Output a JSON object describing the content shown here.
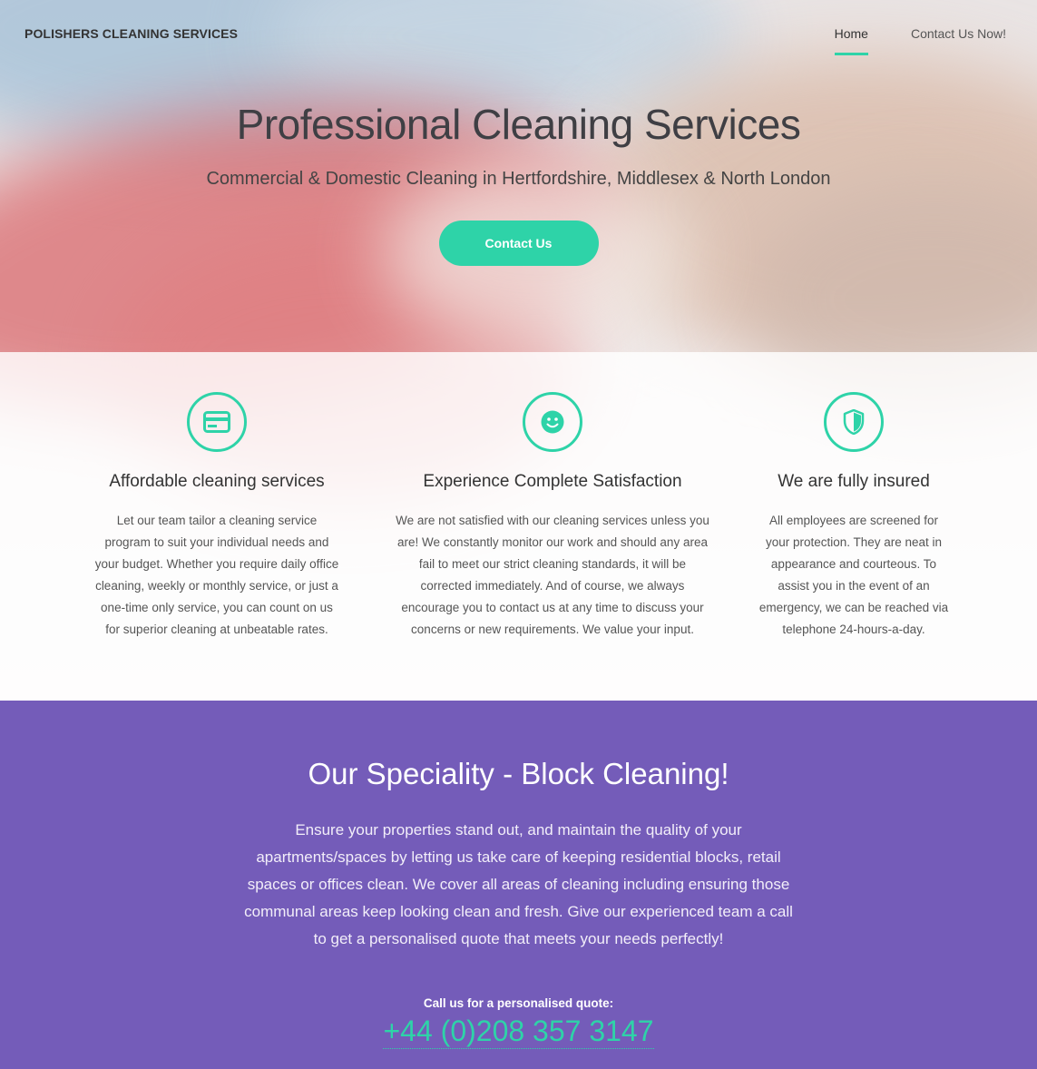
{
  "header": {
    "brand": "POLISHERS CLEANING SERVICES",
    "nav": [
      {
        "label": "Home",
        "active": true
      },
      {
        "label": "Contact Us Now!",
        "active": false
      }
    ]
  },
  "hero": {
    "title": "Professional Cleaning Services",
    "subtitle": "Commercial & Domestic Cleaning in Hertfordshire, Middlesex & North London",
    "cta_label": "Contact Us"
  },
  "features": [
    {
      "icon": "credit-card-icon",
      "title": "Affordable cleaning services",
      "text": "Let our team tailor a cleaning service program to suit your individual needs and your budget. Whether you require daily office cleaning, weekly or monthly service, or just a one-time only service, you can count on us for superior cleaning at unbeatable rates."
    },
    {
      "icon": "smiley-face-icon",
      "title": "Experience Complete Satisfaction",
      "text": "We are not satisfied with our cleaning services unless you are! We constantly monitor our work and should any area fail to meet our strict cleaning standards, it will be corrected immediately. And of course, we always encourage you to contact us at any time to discuss your concerns or new requirements. We value your input."
    },
    {
      "icon": "shield-icon",
      "title": "We are fully insured",
      "text": "All employees are screened for your protection. They are neat in appearance and courteous. To assist you in the event of an emergency, we can be reached via telephone 24-hours-a-day."
    }
  ],
  "speciality": {
    "title": "Our Speciality - Block Cleaning!",
    "text": "Ensure your properties stand out, and maintain the quality of your apartments/spaces by letting us take care of keeping residential blocks, retail spaces or offices clean. We cover all areas of cleaning including ensuring those communal areas keep looking clean and fresh. Give our experienced team a call to get a personalised quote that meets your needs perfectly!",
    "quote_label": "Call us for a personalised quote:",
    "phone": "+44 (0)208 357 3147"
  },
  "colors": {
    "accent": "#2ed3a8",
    "speciality_bg": "#745cb9"
  }
}
